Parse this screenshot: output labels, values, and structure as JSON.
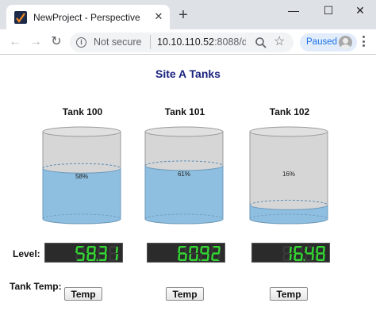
{
  "browser": {
    "tab_title": "NewProject - Perspective",
    "tab_close_glyph": "✕",
    "new_tab_glyph": "+",
    "minimize_glyph": "—",
    "maximize_glyph": "☐",
    "close_glyph": "✕",
    "back_glyph": "←",
    "forward_glyph": "→",
    "reload_glyph": "↻",
    "security_label": "Not secure",
    "url_host": "10.10.110.52",
    "url_rest": ":8088/d...",
    "profile_status": "Paused",
    "colors": {
      "tabbar": "#dee1e6",
      "accent": "#1a73e8"
    }
  },
  "page": {
    "title": "Site A Tanks",
    "level_label": "Level:",
    "temp_label": "Tank Temp:",
    "title_color": "#1a237e"
  },
  "tanks": [
    {
      "name": "Tank 100",
      "level_percent": 58,
      "level_text": "58%",
      "led_value": "58.31",
      "temp_button": "Temp"
    },
    {
      "name": "Tank 101",
      "level_percent": 61,
      "level_text": "61%",
      "led_value": "60.92",
      "temp_button": "Temp"
    },
    {
      "name": "Tank 102",
      "level_percent": 16,
      "level_text": "16%",
      "led_value": "16.48",
      "temp_button": "Temp"
    }
  ],
  "colors": {
    "liquid": "#8fbfe0",
    "tank_body": "#d6d6d6",
    "led_on": "#33d633",
    "led_off": "#3a3a3a"
  }
}
